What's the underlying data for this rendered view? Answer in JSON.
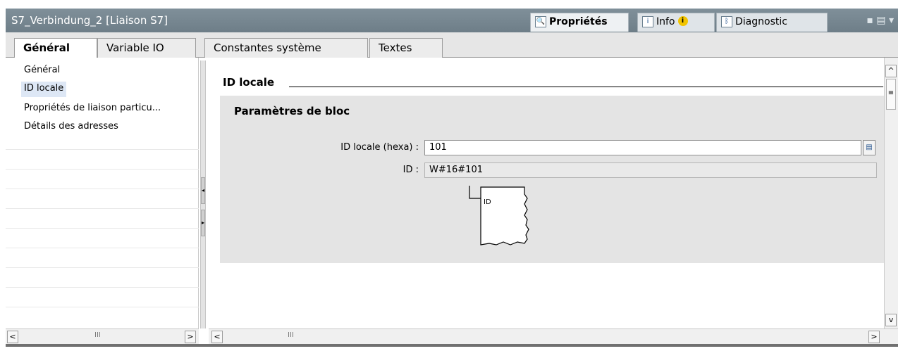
{
  "window": {
    "title": "S7_Verbindung_2 [Liaison S7]",
    "inspector_tabs": [
      {
        "label": "Propriétés",
        "icon": "properties-icon",
        "active": true
      },
      {
        "label": "Info",
        "icon": "info-icon",
        "active": false
      },
      {
        "label": "Diagnostic",
        "icon": "diagnostic-icon",
        "active": false
      }
    ],
    "controls": "▪ ▤ ▾"
  },
  "tabs": [
    {
      "label": "Général",
      "active": true
    },
    {
      "label": "Variable IO",
      "active": false
    },
    {
      "label": "Constantes système",
      "active": false
    },
    {
      "label": "Textes",
      "active": false
    }
  ],
  "nav": {
    "items": [
      {
        "label": "Général",
        "selected": false
      },
      {
        "label": "ID locale",
        "selected": true
      },
      {
        "label": "Propriétés de liaison particu...",
        "selected": false
      },
      {
        "label": "Détails des adresses",
        "selected": false
      }
    ]
  },
  "main": {
    "section_title": "ID locale",
    "param_box_title": "Paramètres de bloc",
    "fields": {
      "id_locale_hexa_label": "ID locale (hexa) :",
      "id_locale_hexa_value": "101",
      "id_label": "ID :",
      "id_value": "W#16#101"
    },
    "diagram_label": "ID"
  },
  "scroll": {
    "left_thumb": "III",
    "main_thumb": "III"
  },
  "colors": {
    "titlebar": "#7a8a94",
    "selected_nav": "#dde7f5",
    "param_box": "#e4e4e4"
  }
}
